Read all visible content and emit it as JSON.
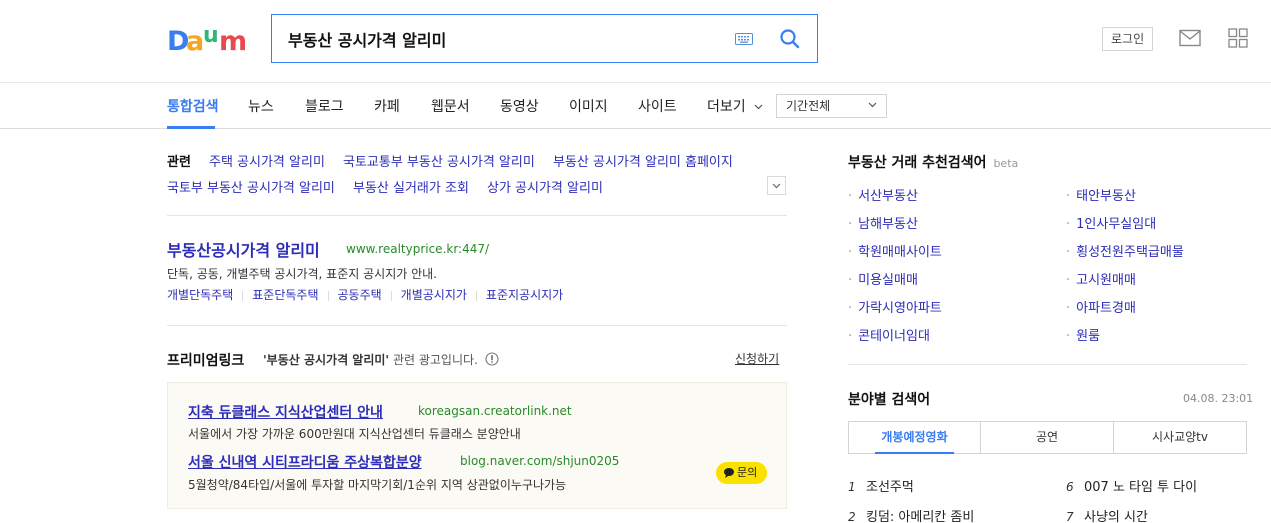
{
  "header": {
    "logo_text": "Daum",
    "search_value": "부동산 공시가격 알리미",
    "login_label": "로그인"
  },
  "tabs": {
    "items": [
      "통합검색",
      "뉴스",
      "블로그",
      "카페",
      "웹문서",
      "동영상",
      "이미지",
      "사이트",
      "더보기"
    ],
    "active": "통합검색",
    "period": "기간전체"
  },
  "related": {
    "title": "관련",
    "links": [
      "주택 공시가격 알리미",
      "국토교통부 부동산 공시가격 알리미",
      "부동산 공시가격 알리미 홈페이지",
      "국토부 부동산 공시가격 알리미",
      "부동산 실거래가 조회",
      "상가 공시가격 알리미"
    ]
  },
  "site_result": {
    "title": "부동산공시가격 알리미",
    "url": "www.realtyprice.kr:447/",
    "description": "단독, 공동, 개별주택 공시가격, 표준지 공시지가 안내.",
    "sub_links": [
      "개별단독주택",
      "표준단독주택",
      "공동주택",
      "개별공시지가",
      "표준지공시지가"
    ]
  },
  "premium": {
    "title": "프리미엄링크",
    "query": "'부동산 공시가격 알리미'",
    "note": "관련 광고입니다.",
    "apply_label": "신청하기",
    "ads": [
      {
        "title": "지축 듀클래스 지식산업센터 안내",
        "url": "koreagsan.creatorlink.net",
        "desc": "서울에서 가장 가까운 600만원대 지식산업센터 듀클래스 분양안내"
      },
      {
        "title": "서울 신내역 시티프라디움 주상복합분양",
        "url": "blog.naver.com/shjun0205",
        "desc": "5월청약/84타입/서울에 투자할 마지막기회/1순위 지역 상관없이누구나가능"
      }
    ],
    "inquiry_label": "문의"
  },
  "recommend": {
    "title": "부동산 거래 추천검색어",
    "beta": "beta",
    "left": [
      "서산부동산",
      "남해부동산",
      "학원매매사이트",
      "미용실매매",
      "가락시영아파트",
      "콘테이너임대"
    ],
    "right": [
      "태안부동산",
      "1인사무실임대",
      "횡성전원주택급매물",
      "고시원매매",
      "아파트경매",
      "원룸"
    ]
  },
  "field_search": {
    "title": "분야별 검색어",
    "time": "04.08. 23:01",
    "tabs": [
      "개봉예정영화",
      "공연",
      "시사교양tv"
    ],
    "active_tab": "개봉예정영화",
    "ranks_left": [
      {
        "num": "1",
        "text": "조선주먹"
      },
      {
        "num": "2",
        "text": "킹덤: 아메리칸 좀비"
      }
    ],
    "ranks_right": [
      {
        "num": "6",
        "text": "007 노 타임 투 다이"
      },
      {
        "num": "7",
        "text": "사냥의 시간"
      }
    ]
  },
  "colors": {
    "accent": "#3a7df0",
    "link": "#2d2dba",
    "url_green": "#2a8a2a",
    "inquiry_yellow": "#fae100"
  }
}
